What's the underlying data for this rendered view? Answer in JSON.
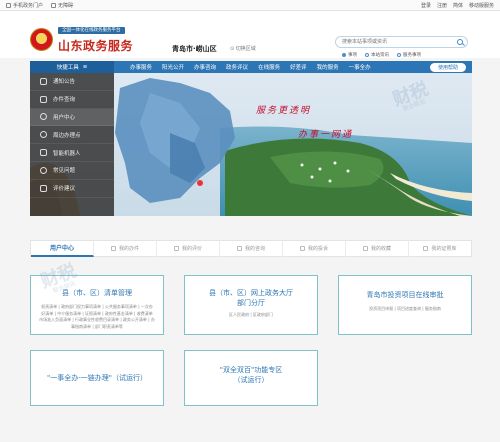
{
  "topbar": {
    "left": [
      "手机政务门户",
      "无障碍"
    ],
    "right": [
      "登录",
      "注册",
      "简体",
      "移动版服务"
    ]
  },
  "header": {
    "org_small": "全国一体化在线政务服务平台",
    "title": "山东政务服务",
    "region": "青岛市·崂山区",
    "region_switch": "切换区域",
    "search_placeholder": "搜索本站事项或资讯",
    "radios": [
      "事项",
      "本站资讯",
      "服务事项"
    ]
  },
  "nav": {
    "quick": "快捷工具",
    "items": [
      "办事服务",
      "阳光公开",
      "办事咨询",
      "政务评议",
      "在线服务",
      "好差评",
      "我的服务",
      "一事全办"
    ],
    "guide": "使用帮助"
  },
  "sidemenu": [
    {
      "label": "通知公告",
      "icon": "megaphone-icon"
    },
    {
      "label": "办件查询",
      "icon": "document-icon"
    },
    {
      "label": "用户中心",
      "icon": "user-icon"
    },
    {
      "label": "周边办理点",
      "icon": "location-icon"
    },
    {
      "label": "智能机器人",
      "icon": "robot-icon"
    },
    {
      "label": "常见问题",
      "icon": "question-icon"
    },
    {
      "label": "评价建议",
      "icon": "edit-icon"
    }
  ],
  "banner": {
    "slogan1": "服务更透明",
    "slogan2": "办事一网通"
  },
  "tabs": [
    "用户中心",
    "我的办件",
    "我的评价",
    "我的咨询",
    "我的投诉",
    "我的收藏",
    "我的证照库"
  ],
  "cards": [
    {
      "title": "县（市、区）清单管理",
      "lines": [
        "权责清单 | 政府部门权力事项清单 | 公共服务事项清单 | 一次办",
        "好清单 | 中介服务清单 | 证照清单 | 政府性基金清单 | 收费清单",
        "市场准入负面清单 | 行政事业性收费目录清单 | 政务公开清单 | 办",
        "事指南清单 | 部门职责清单等"
      ]
    },
    {
      "title": "县（市、区）网上政务大厅",
      "title2": "部门分厅",
      "lines": [
        "区人民政府 | 区政府部门"
      ]
    },
    {
      "title": "青岛市投资项目在线审批",
      "lines": [
        "投资项目申报 | 项目进度查询 | 服务指南"
      ]
    },
    {
      "title": "\"一事全办-一链办理\"（试运行）",
      "lines": []
    },
    {
      "title": "\"双全双百\"功能专区",
      "title2": "（试运行）",
      "lines": []
    }
  ],
  "watermark": {
    "main": "财税",
    "sub": "聚合联拓"
  }
}
